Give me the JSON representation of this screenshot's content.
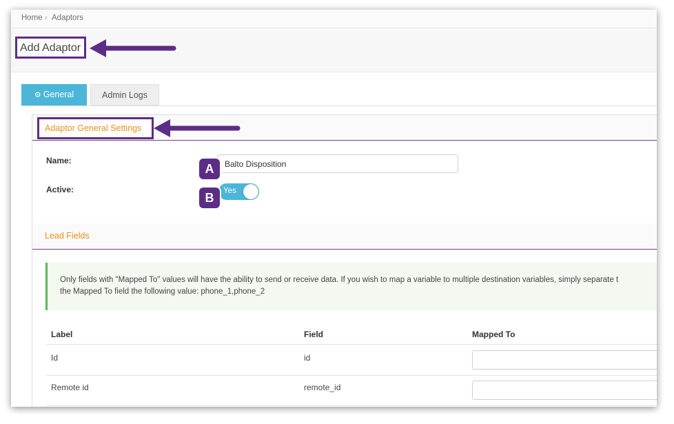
{
  "breadcrumb": {
    "home": "Home",
    "separator": "›",
    "current": "Adaptors"
  },
  "page": {
    "title": "Add Adaptor"
  },
  "tabs": [
    {
      "label": "General",
      "active": true,
      "icon": "gears-icon"
    },
    {
      "label": "Admin Logs",
      "active": false
    }
  ],
  "general_settings": {
    "heading": "Adaptor General Settings",
    "name_label": "Name:",
    "name_value": "Balto Disposition",
    "active_label": "Active:",
    "active_toggle_text": "Yes",
    "active_state": true
  },
  "annotations": {
    "badge_a": "A",
    "badge_b": "B"
  },
  "lead_fields": {
    "heading": "Lead Fields",
    "info_line1": "Only fields with \"Mapped To\" values will have the ability to send or receive data. If you wish to map a variable to multiple destination variables, simply separate t",
    "info_line2": "the Mapped To field the following value: phone_1,phone_2",
    "columns": {
      "label": "Label",
      "field": "Field",
      "mapped_to": "Mapped To"
    },
    "rows": [
      {
        "label": "Id",
        "field": "id",
        "mapped_to": ""
      },
      {
        "label": "Remote id",
        "field": "remote_id",
        "mapped_to": ""
      }
    ]
  },
  "colors": {
    "accent_tab": "#4bb6d8",
    "annotation_purple": "#5c2d86",
    "section_heading": "#e8921c",
    "info_border": "#5cb85c"
  }
}
